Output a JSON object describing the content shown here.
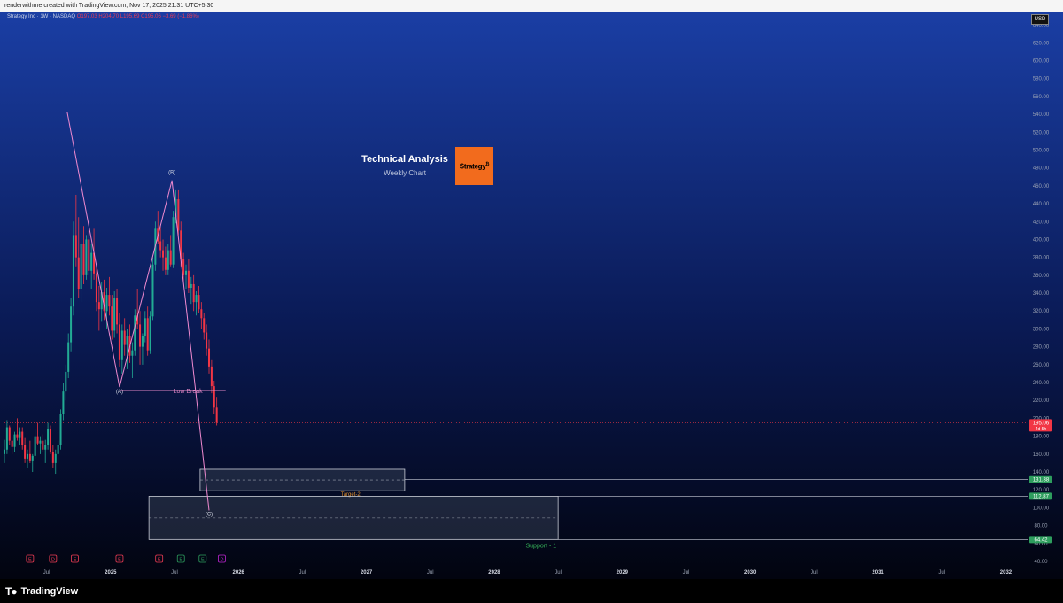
{
  "header": {
    "caption": "renderwithme created with TradingView.com, Nov 17, 2025 21:31 UTC+5:30"
  },
  "symbol": {
    "name": "Strategy Inc · 1W · NASDAQ",
    "ohlc": "O197.03  H204.70  L195.69  C195.06  −3.69 (−1.86%)"
  },
  "currency": "USD",
  "title": {
    "main": "Technical Analysis",
    "sub": "Weekly Chart"
  },
  "company_logo_text": "Strategy",
  "footer": {
    "brand": "TradingView",
    "logo_icon": "tradingview-logo-icon"
  },
  "chart_data": {
    "type": "candlestick",
    "interval": "1W",
    "y_axis": {
      "range": [
        40,
        650
      ],
      "ticks": [
        "640.00",
        "620.00",
        "600.00",
        "580.00",
        "560.00",
        "540.00",
        "520.00",
        "500.00",
        "480.00",
        "460.00",
        "440.00",
        "420.00",
        "400.00",
        "380.00",
        "360.00",
        "340.00",
        "320.00",
        "300.00",
        "280.00",
        "260.00",
        "240.00",
        "220.00",
        "200.00",
        "180.00",
        "160.00",
        "140.00",
        "120.00",
        "100.00",
        "80.00",
        "60.00",
        "40.00"
      ],
      "tick_values": [
        640,
        620,
        600,
        580,
        560,
        540,
        520,
        500,
        480,
        460,
        440,
        420,
        400,
        380,
        360,
        340,
        320,
        300,
        280,
        260,
        240,
        220,
        200,
        180,
        160,
        140,
        120,
        100,
        80,
        60,
        40
      ]
    },
    "x_axis": {
      "labels": [
        "Jul",
        "2025",
        "Jul",
        "2026",
        "Jul",
        "2027",
        "Jul",
        "2028",
        "Jul",
        "2029",
        "Jul",
        "2030",
        "Jul",
        "2031",
        "Jul",
        "2032"
      ],
      "positions": [
        2024.5,
        2025,
        2025.5,
        2026,
        2026.5,
        2027,
        2027.5,
        2028,
        2028.5,
        2029,
        2029.5,
        2030,
        2030.5,
        2031,
        2031.5,
        2032
      ],
      "range": [
        2024.17,
        2032.17
      ]
    },
    "price_tags": [
      {
        "label": "195.06",
        "sub": "4d 5h",
        "value": 195.06,
        "color": "#f23645"
      },
      {
        "label": "131.38",
        "value": 131.38,
        "color": "#2e9e5e"
      },
      {
        "label": "112.87",
        "value": 112.87,
        "color": "#2e9e5e"
      },
      {
        "label": "64.42",
        "value": 64.42,
        "color": "#2e9e5e"
      }
    ],
    "events": [
      {
        "label": "E",
        "t": 2024.37,
        "color": "#ef3d55"
      },
      {
        "label": "D",
        "t": 2024.55,
        "color": "#ef3d55"
      },
      {
        "label": "E",
        "t": 2024.72,
        "color": "#ef3d55"
      },
      {
        "label": "E",
        "t": 2025.07,
        "color": "#ef3d55"
      },
      {
        "label": "E",
        "t": 2025.38,
        "color": "#ef3d55"
      },
      {
        "label": "E",
        "t": 2025.55,
        "color": "#2e9e5e"
      },
      {
        "label": "E",
        "t": 2025.72,
        "color": "#2e9e5e"
      },
      {
        "label": "D",
        "t": 2025.87,
        "color": "#c026d3"
      }
    ],
    "annotations": {
      "wave_labels": [
        {
          "label": "(A)",
          "t": 2025.07,
          "value": 228
        },
        {
          "label": "(B)",
          "t": 2025.48,
          "value": 473
        },
        {
          "label": "(C)",
          "t": 2025.77,
          "value": 91
        }
      ],
      "wave_path": [
        {
          "t": 2024.66,
          "value": 543
        },
        {
          "t": 2025.07,
          "value": 235
        },
        {
          "t": 2025.48,
          "value": 466
        },
        {
          "t": 2025.77,
          "value": 97
        }
      ],
      "low_break": {
        "label": "Low Break",
        "value": 231,
        "t_start": 2025.07,
        "t_end": 2025.9
      },
      "target_zone": {
        "label": "Target-2",
        "low": 119,
        "high": 143,
        "t_start": 2025.7,
        "t_end": 2027.3
      },
      "support_zone": {
        "label": "Support - 1",
        "low": 64.42,
        "high": 112.87,
        "t_start": 2025.3,
        "t_end": 2028.5
      },
      "current_price": 195.06
    },
    "candles_weekly": [
      [
        2024.17,
        160,
        176,
        150,
        165
      ],
      [
        2024.19,
        165,
        198,
        160,
        190
      ],
      [
        2024.21,
        190,
        192,
        170,
        175
      ],
      [
        2024.23,
        175,
        180,
        160,
        168
      ],
      [
        2024.25,
        168,
        185,
        162,
        182
      ],
      [
        2024.27,
        182,
        200,
        175,
        178
      ],
      [
        2024.29,
        178,
        190,
        170,
        185
      ],
      [
        2024.31,
        185,
        190,
        165,
        170
      ],
      [
        2024.33,
        170,
        178,
        150,
        155
      ],
      [
        2024.35,
        155,
        165,
        145,
        160
      ],
      [
        2024.37,
        160,
        175,
        150,
        152
      ],
      [
        2024.39,
        152,
        160,
        140,
        158
      ],
      [
        2024.41,
        158,
        188,
        155,
        180
      ],
      [
        2024.43,
        180,
        195,
        170,
        172
      ],
      [
        2024.45,
        172,
        180,
        160,
        175
      ],
      [
        2024.47,
        175,
        182,
        162,
        165
      ],
      [
        2024.49,
        165,
        176,
        150,
        170
      ],
      [
        2024.51,
        170,
        195,
        165,
        188
      ],
      [
        2024.53,
        188,
        192,
        160,
        162
      ],
      [
        2024.55,
        162,
        170,
        145,
        150
      ],
      [
        2024.57,
        150,
        165,
        138,
        160
      ],
      [
        2024.59,
        160,
        175,
        150,
        170
      ],
      [
        2024.61,
        170,
        210,
        165,
        205
      ],
      [
        2024.63,
        205,
        240,
        198,
        230
      ],
      [
        2024.65,
        230,
        260,
        220,
        252
      ],
      [
        2024.67,
        252,
        295,
        245,
        285
      ],
      [
        2024.69,
        285,
        335,
        275,
        325
      ],
      [
        2024.71,
        325,
        420,
        315,
        405
      ],
      [
        2024.73,
        405,
        450,
        370,
        380
      ],
      [
        2024.75,
        380,
        425,
        335,
        345
      ],
      [
        2024.77,
        345,
        410,
        330,
        395
      ],
      [
        2024.79,
        395,
        415,
        350,
        360
      ],
      [
        2024.81,
        360,
        405,
        355,
        400
      ],
      [
        2024.83,
        400,
        410,
        360,
        365
      ],
      [
        2024.85,
        365,
        395,
        345,
        385
      ],
      [
        2024.87,
        385,
        412,
        355,
        362
      ],
      [
        2024.89,
        362,
        372,
        320,
        330
      ],
      [
        2024.91,
        330,
        348,
        298,
        322
      ],
      [
        2024.93,
        322,
        352,
        308,
        341
      ],
      [
        2024.95,
        341,
        355,
        310,
        320
      ],
      [
        2024.97,
        320,
        346,
        300,
        338
      ],
      [
        2024.99,
        338,
        358,
        315,
        325
      ],
      [
        2025.01,
        325,
        338,
        288,
        298
      ],
      [
        2025.03,
        298,
        342,
        290,
        335
      ],
      [
        2025.05,
        335,
        345,
        295,
        305
      ],
      [
        2025.07,
        305,
        318,
        258,
        265
      ],
      [
        2025.09,
        265,
        305,
        250,
        298
      ],
      [
        2025.11,
        298,
        312,
        270,
        282
      ],
      [
        2025.13,
        282,
        300,
        255,
        292
      ],
      [
        2025.15,
        292,
        305,
        262,
        270
      ],
      [
        2025.17,
        270,
        285,
        245,
        276
      ],
      [
        2025.19,
        276,
        322,
        270,
        315
      ],
      [
        2025.21,
        315,
        345,
        300,
        305
      ],
      [
        2025.23,
        305,
        320,
        260,
        280
      ],
      [
        2025.25,
        280,
        295,
        260,
        292
      ],
      [
        2025.27,
        292,
        320,
        285,
        312
      ],
      [
        2025.29,
        312,
        325,
        270,
        276
      ],
      [
        2025.31,
        276,
        320,
        272,
        314
      ],
      [
        2025.33,
        314,
        380,
        310,
        372
      ],
      [
        2025.35,
        372,
        420,
        365,
        412
      ],
      [
        2025.37,
        412,
        432,
        395,
        398
      ],
      [
        2025.39,
        398,
        415,
        380,
        388
      ],
      [
        2025.41,
        388,
        400,
        365,
        380
      ],
      [
        2025.43,
        380,
        392,
        360,
        366
      ],
      [
        2025.45,
        366,
        395,
        360,
        388
      ],
      [
        2025.47,
        388,
        405,
        370,
        372
      ],
      [
        2025.49,
        372,
        432,
        368,
        425
      ],
      [
        2025.51,
        425,
        455,
        418,
        445
      ],
      [
        2025.53,
        445,
        455,
        405,
        410
      ],
      [
        2025.55,
        410,
        420,
        370,
        378
      ],
      [
        2025.57,
        378,
        385,
        352,
        360
      ],
      [
        2025.59,
        360,
        372,
        345,
        365
      ],
      [
        2025.61,
        365,
        378,
        340,
        346
      ],
      [
        2025.63,
        346,
        358,
        328,
        350
      ],
      [
        2025.65,
        350,
        360,
        320,
        330
      ],
      [
        2025.67,
        330,
        342,
        315,
        338
      ],
      [
        2025.69,
        338,
        348,
        318,
        322
      ],
      [
        2025.71,
        322,
        330,
        300,
        312
      ],
      [
        2025.73,
        312,
        318,
        288,
        296
      ],
      [
        2025.75,
        296,
        305,
        270,
        278
      ],
      [
        2025.77,
        278,
        288,
        250,
        258
      ],
      [
        2025.79,
        258,
        265,
        228,
        236
      ],
      [
        2025.81,
        236,
        242,
        205,
        212
      ],
      [
        2025.83,
        212,
        224,
        192,
        195
      ]
    ]
  }
}
